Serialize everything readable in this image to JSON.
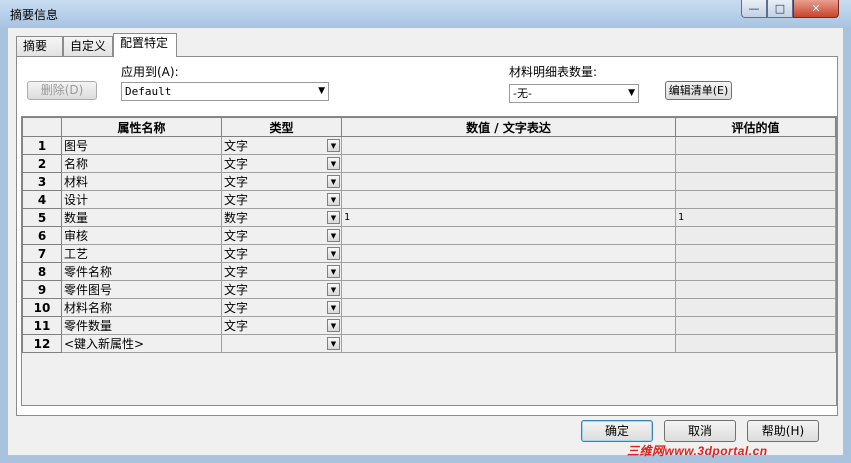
{
  "window": {
    "title": "摘要信息",
    "minimize_glyph": "—",
    "maximize_glyph": "□",
    "close_glyph": "✕"
  },
  "tabs": [
    {
      "label": "摘要",
      "active": false
    },
    {
      "label": "自定义",
      "active": false
    },
    {
      "label": "配置特定",
      "active": true
    }
  ],
  "panel": {
    "delete_button": "删除(D)",
    "apply_to_label": "应用到(A):",
    "apply_to_value": "Default",
    "bom_qty_label": "材料明细表数量:",
    "bom_qty_value": "-无-",
    "edit_list_button": "编辑清单(E)"
  },
  "table": {
    "headers": [
      "属性名称",
      "类型",
      "数值 / 文字表达",
      "评估的值"
    ],
    "rows": [
      {
        "num": "1",
        "name": "图号",
        "type": "文字",
        "value": "",
        "evaluated": ""
      },
      {
        "num": "2",
        "name": "名称",
        "type": "文字",
        "value": "",
        "evaluated": ""
      },
      {
        "num": "3",
        "name": "材料",
        "type": "文字",
        "value": "",
        "evaluated": ""
      },
      {
        "num": "4",
        "name": "设计",
        "type": "文字",
        "value": "",
        "evaluated": ""
      },
      {
        "num": "5",
        "name": "数量",
        "type": "数字",
        "value": "1",
        "evaluated": "1"
      },
      {
        "num": "6",
        "name": "审核",
        "type": "文字",
        "value": "",
        "evaluated": ""
      },
      {
        "num": "7",
        "name": "工艺",
        "type": "文字",
        "value": "",
        "evaluated": ""
      },
      {
        "num": "8",
        "name": "零件名称",
        "type": "文字",
        "value": "",
        "evaluated": ""
      },
      {
        "num": "9",
        "name": "零件图号",
        "type": "文字",
        "value": "",
        "evaluated": ""
      },
      {
        "num": "10",
        "name": "材料名称",
        "type": "文字",
        "value": "",
        "evaluated": ""
      },
      {
        "num": "11",
        "name": "零件数量",
        "type": "文字",
        "value": "",
        "evaluated": ""
      },
      {
        "num": "12",
        "name": "<键入新属性>",
        "type": "",
        "value": "",
        "evaluated": ""
      }
    ]
  },
  "footer": {
    "ok_button": "确定",
    "cancel_button": "取消",
    "help_button": "帮助(H)"
  },
  "watermark": "三维网www.3dportal.cn",
  "dropdown_glyph": "▼"
}
